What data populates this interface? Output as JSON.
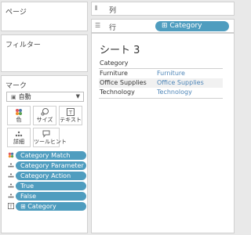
{
  "left_panel": {
    "pages_title": "ページ",
    "filters_title": "フィルター",
    "marks_title": "マーク",
    "mark_type": "自動",
    "mark_buttons": [
      {
        "label": "色",
        "icon": "color-dots-icon"
      },
      {
        "label": "サイズ",
        "icon": "size-icon"
      },
      {
        "label": "テキスト",
        "icon": "text-icon"
      },
      {
        "label": "詳細",
        "icon": "detail-icon"
      },
      {
        "label": "ツールヒント",
        "icon": "tooltip-icon"
      }
    ],
    "mark_fields": [
      {
        "label": "Category Match",
        "icon": "color-dots-icon"
      },
      {
        "label": "Category Parameter",
        "icon": "detail-icon"
      },
      {
        "label": "Category Action",
        "icon": "detail-icon"
      },
      {
        "label": "True",
        "icon": "detail-icon"
      },
      {
        "label": "False",
        "icon": "detail-icon"
      },
      {
        "label": "⊞ Category",
        "icon": "text-icon"
      }
    ]
  },
  "shelves": {
    "columns_label": "列",
    "rows_label": "行",
    "rows_pill": "⊞ Category"
  },
  "sheet": {
    "title": "シート 3",
    "column_header": "Category",
    "rows": [
      {
        "category": "Furniture",
        "value": "Furniture"
      },
      {
        "category": "Office Supplies",
        "value": "Office Supplies"
      },
      {
        "category": "Technology",
        "value": "Technology"
      }
    ]
  },
  "colors": {
    "pill": "#4f9dbf",
    "link_text": "#4f86b8"
  }
}
